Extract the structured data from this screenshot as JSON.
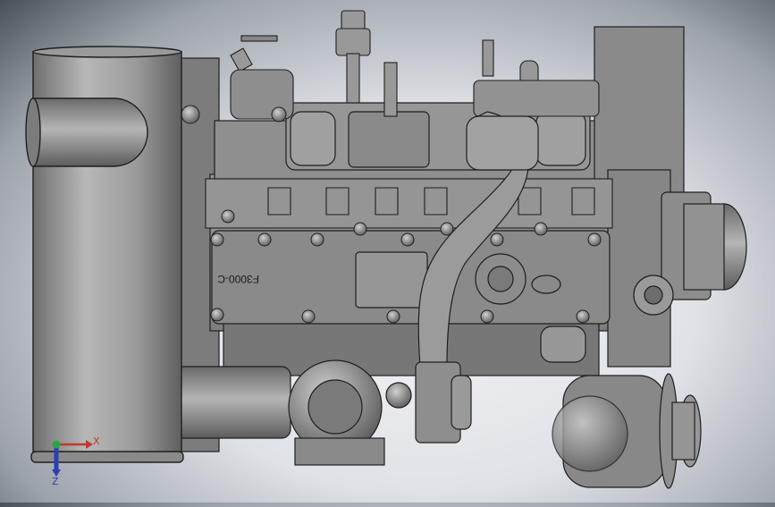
{
  "viewport": {
    "model_label": "F3000-C",
    "axis": {
      "x_label": "X",
      "z_label": "Z"
    },
    "colors": {
      "x_axis": "#c0392b",
      "z_axis": "#2a3fb0",
      "origin": "#27a844",
      "body": "#8c8c8c",
      "edge": "#1e1e1e"
    }
  }
}
